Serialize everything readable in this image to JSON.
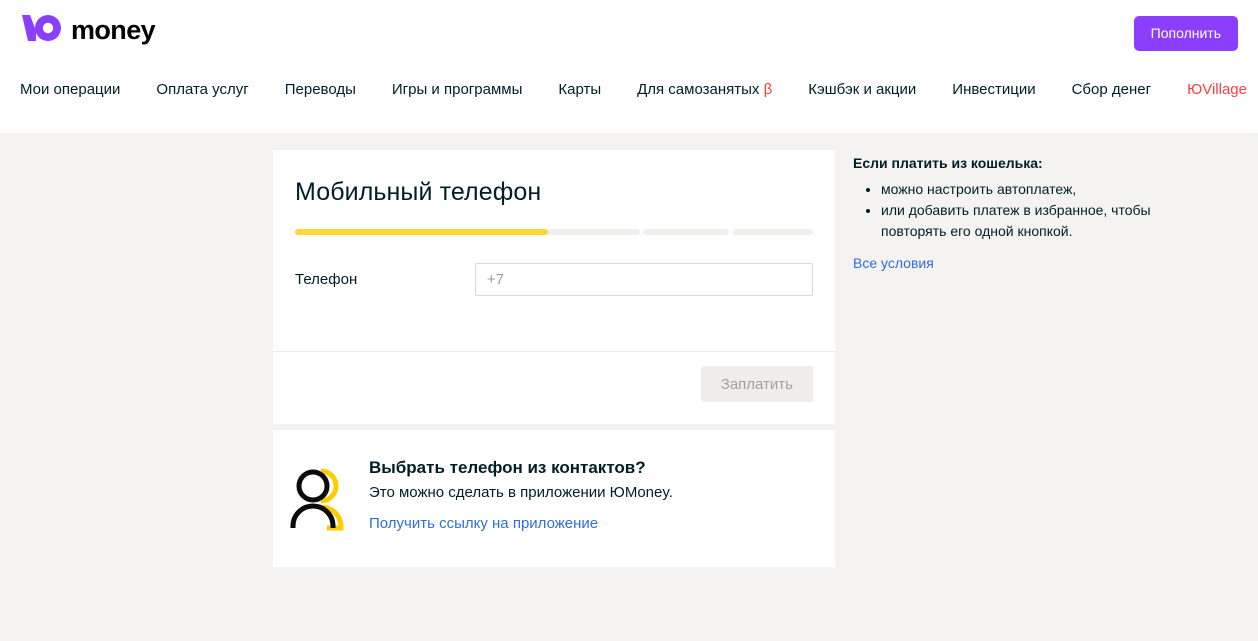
{
  "header": {
    "logo_text": "money",
    "logo_icon": "yoomoney-yu-logo-icon",
    "topup_label": "Пополнить",
    "nav": [
      {
        "label": "Мои операции",
        "accent": false,
        "beta": false
      },
      {
        "label": "Оплата услуг",
        "accent": false,
        "beta": false
      },
      {
        "label": "Переводы",
        "accent": false,
        "beta": false
      },
      {
        "label": "Игры и программы",
        "accent": false,
        "beta": false
      },
      {
        "label": "Карты",
        "accent": false,
        "beta": false
      },
      {
        "label": "Для самозанятых",
        "accent": false,
        "beta": true,
        "beta_label": "β"
      },
      {
        "label": "Кэшбэк и акции",
        "accent": false,
        "beta": false
      },
      {
        "label": "Инвестиции",
        "accent": false,
        "beta": false
      },
      {
        "label": "Сбор денег",
        "accent": false,
        "beta": false
      },
      {
        "label": "ЮVillage",
        "accent": true,
        "beta": false
      }
    ]
  },
  "main_card": {
    "title": "Мобильный телефон",
    "progress": {
      "steps": 3,
      "current": 1,
      "fill_percent": 67
    },
    "form": {
      "phone_label": "Телефон",
      "phone_value": "",
      "phone_placeholder": "+7"
    },
    "pay_button": {
      "label": "Заплатить",
      "disabled": true
    }
  },
  "contacts_card": {
    "icon": "two-people-contacts-icon",
    "title": "Выбрать телефон из контактов?",
    "subtitle": "Это можно сделать в приложении ЮMoney.",
    "link_label": "Получить ссылку на приложение"
  },
  "sidebar": {
    "title": "Если платить из кошелька:",
    "bullets": [
      "можно настроить автоплатеж,",
      "или добавить платеж в избранное, чтобы повторять его одной кнопкой."
    ],
    "link_label": "Все условия"
  },
  "colors": {
    "brand_purple": "#8b3ffd",
    "accent_red": "#f5413f",
    "progress_yellow": "#ffd633",
    "link_blue": "#2f6fd9",
    "page_background": "#f4f3f1",
    "card_background": "#ffffff",
    "icon_yellow": "#ffcc00",
    "text_primary": "#001e26"
  }
}
